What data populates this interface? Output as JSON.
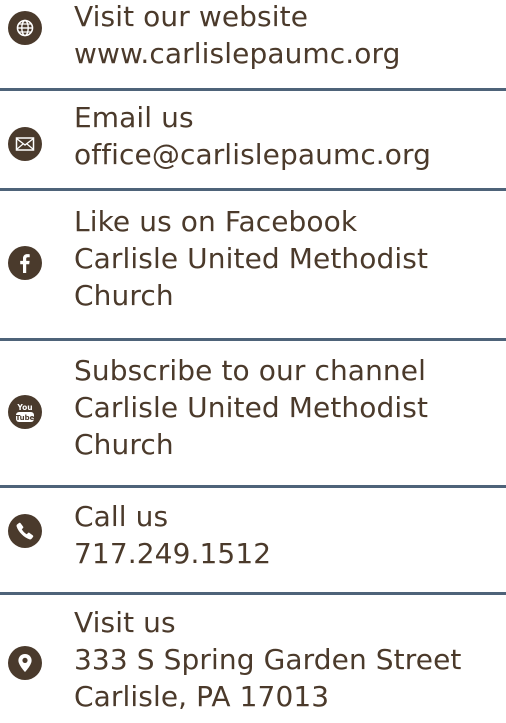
{
  "colors": {
    "text": "#4b3a2b",
    "icon_bg": "#4a3a2c",
    "divider": "#4e6379"
  },
  "items": [
    {
      "icon": "globe-icon",
      "lines": [
        "Visit our website",
        "www.carlislepaumc.org"
      ]
    },
    {
      "icon": "envelope-icon",
      "lines": [
        "Email us",
        "office@carlislepaumc.org"
      ]
    },
    {
      "icon": "facebook-icon",
      "lines": [
        "Like us on Facebook",
        "Carlisle United Methodist",
        "Church"
      ]
    },
    {
      "icon": "youtube-icon",
      "icon_text": [
        "You",
        "Tube"
      ],
      "lines": [
        "Subscribe to our channel",
        "Carlisle United Methodist",
        "Church"
      ]
    },
    {
      "icon": "phone-icon",
      "lines": [
        "Call us",
        "717.249.1512"
      ]
    },
    {
      "icon": "map-pin-icon",
      "lines": [
        "Visit us",
        "333 S Spring Garden Street",
        "Carlisle, PA 17013"
      ]
    }
  ]
}
